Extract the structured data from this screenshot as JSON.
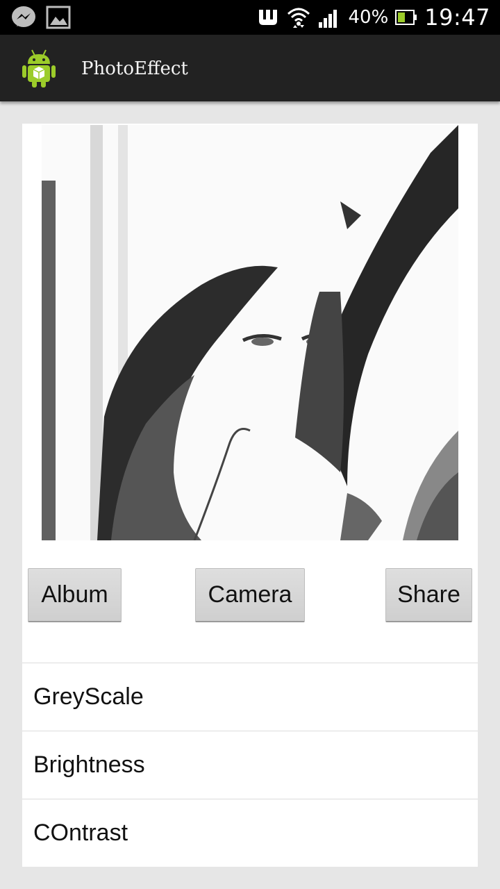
{
  "status_bar": {
    "battery_percent": "40%",
    "time": "19:47",
    "icons": [
      "messenger-icon",
      "gallery-icon",
      "nfc-icon",
      "wifi-icon",
      "signal-icon",
      "battery-icon"
    ]
  },
  "action_bar": {
    "title": "PhotoEffect",
    "icon": "android-app-icon"
  },
  "buttons": {
    "album": "Album",
    "camera": "Camera",
    "share": "Share"
  },
  "effects": [
    {
      "label": "GreyScale"
    },
    {
      "label": "Brightness"
    },
    {
      "label": "COntrast"
    }
  ],
  "colors": {
    "status_bar": "#000000",
    "action_bar": "#222222",
    "background": "#e6e6e6",
    "card": "#ffffff",
    "battery_fill": "#9ccc2a"
  }
}
